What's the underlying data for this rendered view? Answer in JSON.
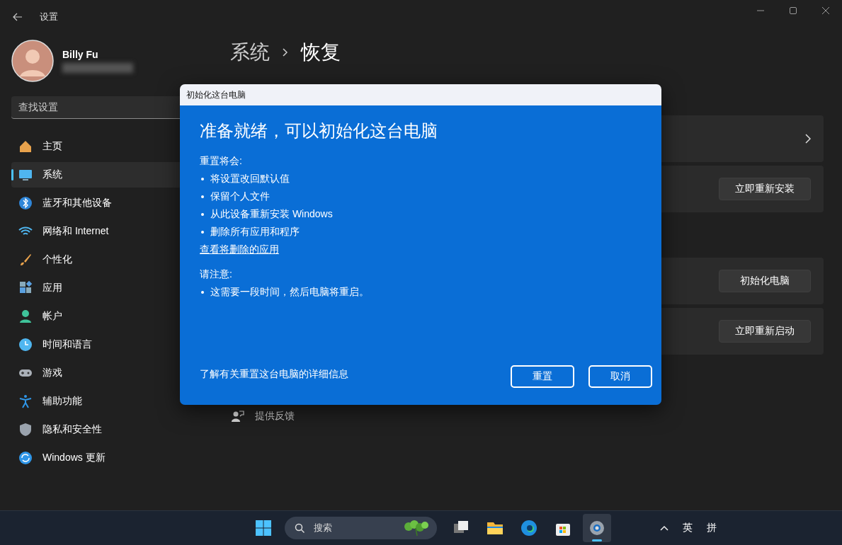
{
  "window": {
    "title": "设置"
  },
  "user": {
    "name": "Billy Fu"
  },
  "search": {
    "placeholder": "查找设置"
  },
  "sidebar": {
    "items": [
      {
        "label": "主页",
        "selected": false
      },
      {
        "label": "系统",
        "selected": true
      },
      {
        "label": "蓝牙和其他设备",
        "selected": false
      },
      {
        "label": "网络和 Internet",
        "selected": false
      },
      {
        "label": "个性化",
        "selected": false
      },
      {
        "label": "应用",
        "selected": false
      },
      {
        "label": "帐户",
        "selected": false
      },
      {
        "label": "时间和语言",
        "selected": false
      },
      {
        "label": "游戏",
        "selected": false
      },
      {
        "label": "辅助功能",
        "selected": false
      },
      {
        "label": "隐私和安全性",
        "selected": false
      },
      {
        "label": "Windows 更新",
        "selected": false
      }
    ]
  },
  "breadcrumb": {
    "parent": "系统",
    "current": "恢复"
  },
  "sections": [
    {
      "cards": [
        {
          "kind": "link"
        },
        {
          "kind": "button",
          "button": "立即重新安装"
        }
      ]
    },
    {
      "cards": [
        {
          "kind": "button",
          "button": "初始化电脑"
        },
        {
          "kind": "button",
          "button": "立即重新启动"
        }
      ]
    }
  ],
  "feedback": "提供反馈",
  "dialog": {
    "title": "初始化这台电脑",
    "heading": "准备就绪，可以初始化这台电脑",
    "intro": "重置将会:",
    "items": [
      "将设置改回默认值",
      "保留个人文件",
      "从此设备重新安装 Windows",
      "删除所有应用和程序"
    ],
    "link": "查看将删除的应用",
    "note_heading": "请注意:",
    "note_items": [
      "这需要一段时间，然后电脑将重启。"
    ],
    "footer_link": "了解有关重置这台电脑的详细信息",
    "buttons": [
      "重置",
      "取消"
    ]
  },
  "taskbar": {
    "search": {
      "placeholder": "搜索"
    },
    "apps": [
      {
        "selected": false
      },
      {
        "selected": false
      },
      {
        "selected": false
      },
      {
        "selected": false
      },
      {
        "selected": true
      }
    ],
    "tray": [
      "英",
      "拼"
    ]
  }
}
